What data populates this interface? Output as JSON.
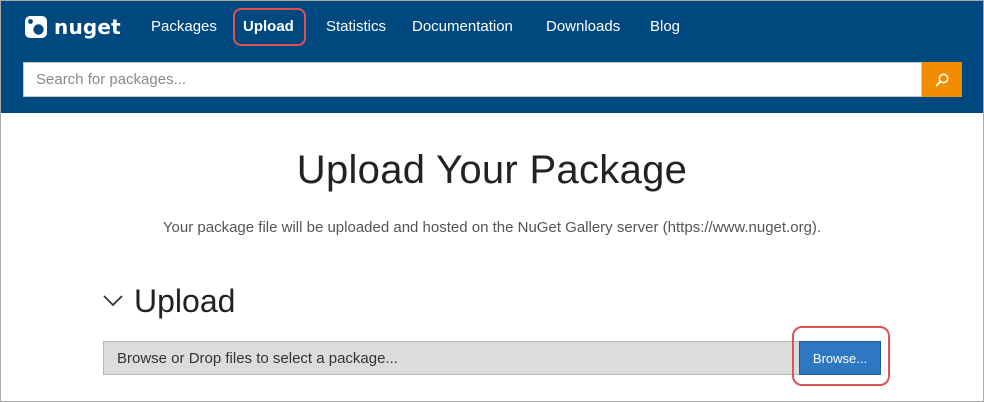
{
  "brand": {
    "name": "nuget",
    "logo_icon": "nuget-logo-icon"
  },
  "nav": {
    "items": [
      {
        "label": "Packages",
        "active": false
      },
      {
        "label": "Upload",
        "active": true
      },
      {
        "label": "Statistics",
        "active": false
      },
      {
        "label": "Documentation",
        "active": false
      },
      {
        "label": "Downloads",
        "active": false
      },
      {
        "label": "Blog",
        "active": false
      }
    ]
  },
  "search": {
    "placeholder": "Search for packages...",
    "button_icon": "search-icon"
  },
  "main": {
    "title": "Upload Your Package",
    "subtitle": "Your package file will be uploaded and hosted on the NuGet Gallery server (https://www.nuget.org).",
    "section": {
      "label": "Upload",
      "toggle_icon": "chevron-down-icon",
      "drop_text": "Browse or Drop files to select a package...",
      "browse_label": "Browse..."
    }
  },
  "colors": {
    "header_bg": "#004880",
    "search_button": "#f28c00",
    "browse_button": "#2e78c2",
    "annotation": "#e05252"
  }
}
